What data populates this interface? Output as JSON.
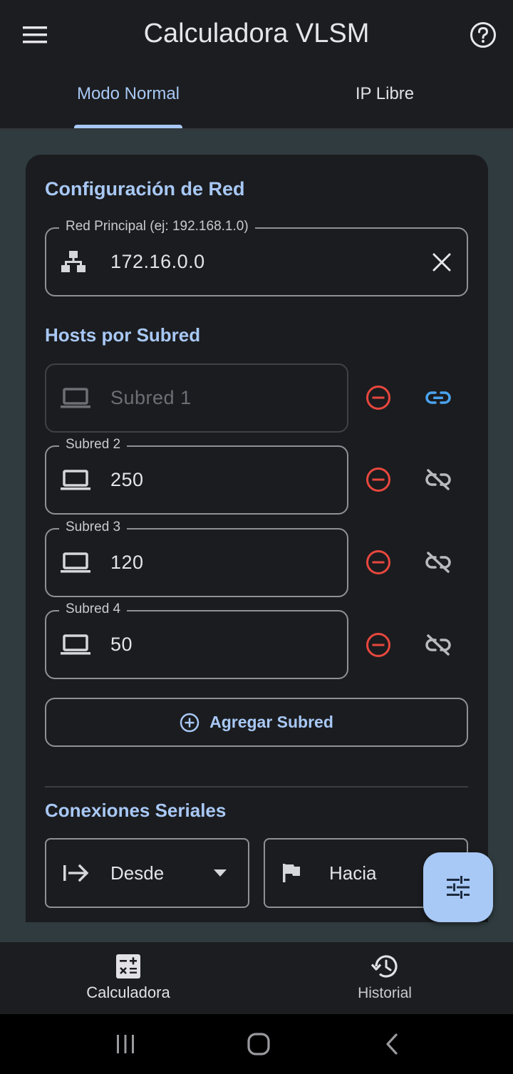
{
  "app": {
    "title": "Calculadora VLSM"
  },
  "tabs": [
    {
      "label": "Modo Normal",
      "selected": true
    },
    {
      "label": "IP Libre",
      "selected": false
    }
  ],
  "config": {
    "title": "Configuración de Red",
    "network": {
      "label": "Red Principal (ej: 192.168.1.0)",
      "value": "172.16.0.0"
    }
  },
  "hosts": {
    "title": "Hosts por Subred",
    "subnets": [
      {
        "label": "Subred 1",
        "value": "",
        "placeholder": "Subred 1",
        "linked": true,
        "enabled": false
      },
      {
        "label": "Subred 2",
        "value": "250",
        "linked": false,
        "enabled": true
      },
      {
        "label": "Subred 3",
        "value": "120",
        "linked": false,
        "enabled": true
      },
      {
        "label": "Subred 4",
        "value": "50",
        "linked": false,
        "enabled": true
      }
    ],
    "add_label": "Agregar Subred"
  },
  "serial": {
    "title": "Conexiones Seriales",
    "from_label": "Desde",
    "to_label": "Hacia"
  },
  "bottom_nav": [
    {
      "label": "Calculadora",
      "icon": "calculator-icon",
      "selected": true
    },
    {
      "label": "Historial",
      "icon": "history-icon",
      "selected": false
    }
  ],
  "colors": {
    "accent": "#a8c8f5",
    "remove": "#e8473e",
    "link_active": "#4aa3f0",
    "background": "#1b1c1f",
    "content_bg": "#2f3b3f"
  }
}
